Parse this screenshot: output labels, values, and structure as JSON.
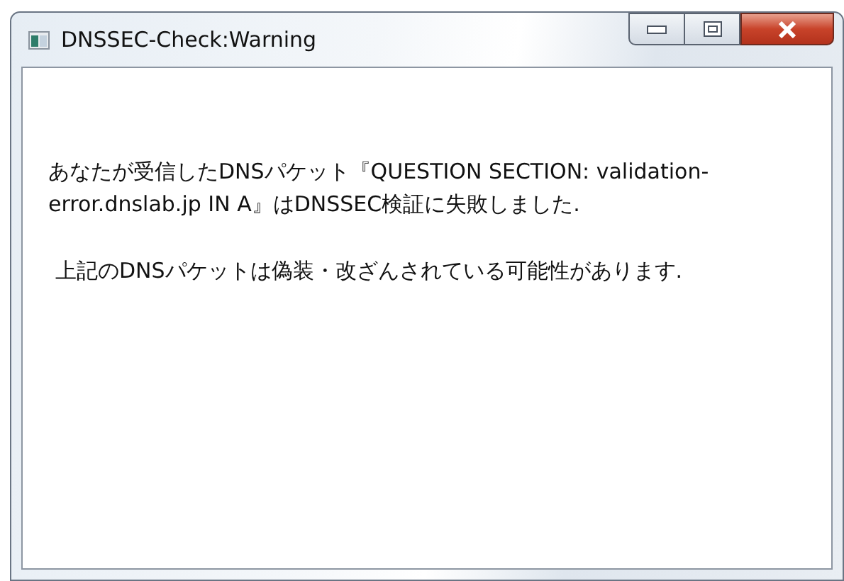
{
  "window": {
    "title": "DNSSEC-Check:Warning"
  },
  "message": {
    "paragraphs": [
      "あなたが受信したDNSパケット『QUESTION SECTION: validation-error.dnslab.jp IN A』はDNSSEC検証に失敗しました.",
      "上記のDNSパケットは偽装・改ざんされている可能性があります."
    ]
  }
}
